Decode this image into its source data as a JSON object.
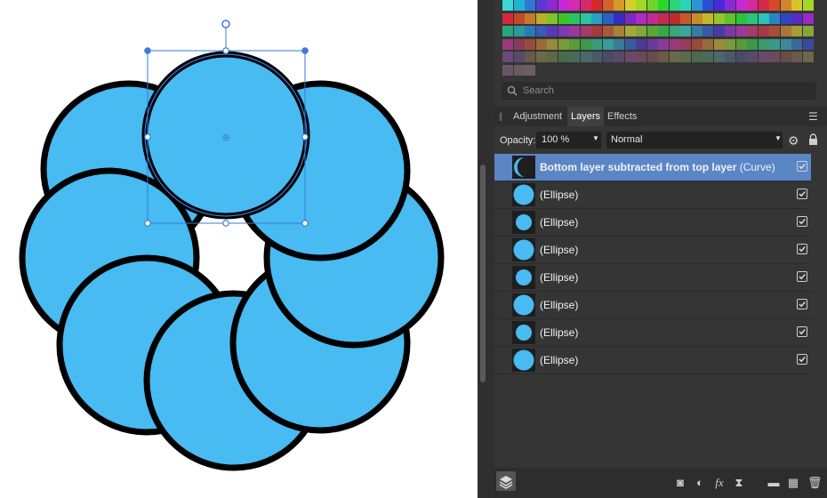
{
  "colors": {
    "fill": "#47bbf2",
    "stroke": "#000000",
    "selection": "#3a7bd5",
    "selected_row": "#5b86c6",
    "panel_bg": "#353535"
  },
  "swatches": {
    "rows": [
      [
        "#3cd7d7",
        "#1fb4d6",
        "#2f78d8",
        "#5a3ad6",
        "#8a2ad0",
        "#c62ad8",
        "#d62ab0",
        "#d62a6e",
        "#d62a2a",
        "#d6622a",
        "#d69a2a",
        "#d6cf2a",
        "#a6d62a",
        "#6ed62a",
        "#2ad62a",
        "#2ad67a",
        "#2ad6b6",
        "#2a96d6",
        "#2a4ed6",
        "#4a2ad6",
        "#8a2ad6",
        "#c42ad6",
        "#d62a9a",
        "#d62a4a",
        "#d64a2a",
        "#d6842a",
        "#d6c42a",
        "#a6d62a"
      ],
      [
        "#d62a3a",
        "#c04a2a",
        "#c47a2a",
        "#b6b02a",
        "#7ec42a",
        "#3ec42a",
        "#2ac462",
        "#2ac4a4",
        "#2a9ec4",
        "#2a62c4",
        "#3a2ac4",
        "#7a2ac4",
        "#b42ac4",
        "#c42a92",
        "#c42a52",
        "#c42a2a",
        "#c45a2a",
        "#c48e2a",
        "#c4b82a",
        "#96c42a",
        "#5ec42a",
        "#2ac43a",
        "#2ac47c",
        "#2ac4b8",
        "#2a84c4",
        "#2a48c4",
        "#5a2ac4",
        "#9a2ac4"
      ],
      [
        "#2aa67a",
        "#2a9a9a",
        "#2a7ab4",
        "#3a5ab4",
        "#5a3ab4",
        "#7a3ab4",
        "#9a3a9a",
        "#a63a6a",
        "#a63a3a",
        "#a65a3a",
        "#a6823a",
        "#a6a63a",
        "#82a63a",
        "#5aa63a",
        "#3aa64a",
        "#3aa67a",
        "#3aa6a0",
        "#3a7aa6",
        "#3a5aa6",
        "#4a3aa6",
        "#7a3aa6",
        "#9a3a9a",
        "#a63a6a",
        "#a63a4a",
        "#a6503a",
        "#a6763a",
        "#a69c3a",
        "#86a63a"
      ],
      [
        "#9a3a7a",
        "#8a3a5a",
        "#9a4a3a",
        "#9a6a3a",
        "#9a8a3a",
        "#7a9a3a",
        "#5a9a3a",
        "#3a9a4a",
        "#3a9a7a",
        "#3a9a9a",
        "#3a7a9a",
        "#3a5a9a",
        "#4a3a9a",
        "#6a3a9a",
        "#8a3a9a",
        "#9a3a7a",
        "#9a3a5a",
        "#9a4a3a",
        "#9a6a3a",
        "#9a8a3a",
        "#7a9a3a",
        "#5a9a3a",
        "#3a9a4a",
        "#3a9a6a",
        "#3a9a8a",
        "#3a8a9a",
        "#3a6a9a",
        "#3a4a9a"
      ],
      [
        "#6a4a7a",
        "#5a4a6a",
        "#6a5a4a",
        "#6a6a4a",
        "#5a6a4a",
        "#4a6a4a",
        "#4a6a5a",
        "#4a6a6a",
        "#4a5a6a",
        "#4a4a6a",
        "#5a4a6a",
        "#6a4a6a",
        "#6a4a5a",
        "#6a4a4a",
        "#6a5a4a",
        "#6a6a4a",
        "#5a6a4a",
        "#4a6a4a",
        "#4a6a5a",
        "#4a6a6a",
        "#4a5a6a",
        "#4a4a6a",
        "#5a4a6a",
        "#6a4a6a",
        "#6a4a5a",
        "#6a4a4a",
        "#6a5a4a",
        "#6a6a4a"
      ],
      [
        "#6a566a",
        "#6a5c5c",
        "#6a6060"
      ]
    ]
  },
  "search": {
    "placeholder": "Search",
    "icon": "search-icon"
  },
  "tabs": [
    {
      "label": "Adjustment",
      "active": false
    },
    {
      "label": "Layers",
      "active": true
    },
    {
      "label": "Effects",
      "active": false
    }
  ],
  "options": {
    "opacity_label": "Opacity:",
    "opacity_value": "100 %",
    "blend_mode": "Normal"
  },
  "layers": [
    {
      "name": "Bottom layer subtracted from top layer",
      "kind": "(Curve)",
      "selected": true,
      "visible": true,
      "thumb": "crescent"
    },
    {
      "name": "",
      "kind": "(Ellipse)",
      "selected": false,
      "visible": true,
      "thumb": "large"
    },
    {
      "name": "",
      "kind": "(Ellipse)",
      "selected": false,
      "visible": true,
      "thumb": "small"
    },
    {
      "name": "",
      "kind": "(Ellipse)",
      "selected": false,
      "visible": true,
      "thumb": "large"
    },
    {
      "name": "",
      "kind": "(Ellipse)",
      "selected": false,
      "visible": true,
      "thumb": "small"
    },
    {
      "name": "",
      "kind": "(Ellipse)",
      "selected": false,
      "visible": true,
      "thumb": "large"
    },
    {
      "name": "",
      "kind": "(Ellipse)",
      "selected": false,
      "visible": true,
      "thumb": "small"
    },
    {
      "name": "",
      "kind": "(Ellipse)",
      "selected": false,
      "visible": true,
      "thumb": "large"
    }
  ],
  "bottom_icons": [
    "layers-icon",
    "mask-icon",
    "adjustment-icon",
    "fx-icon",
    "live-filter-icon",
    "group-icon",
    "rasterize-icon",
    "trash-icon"
  ]
}
